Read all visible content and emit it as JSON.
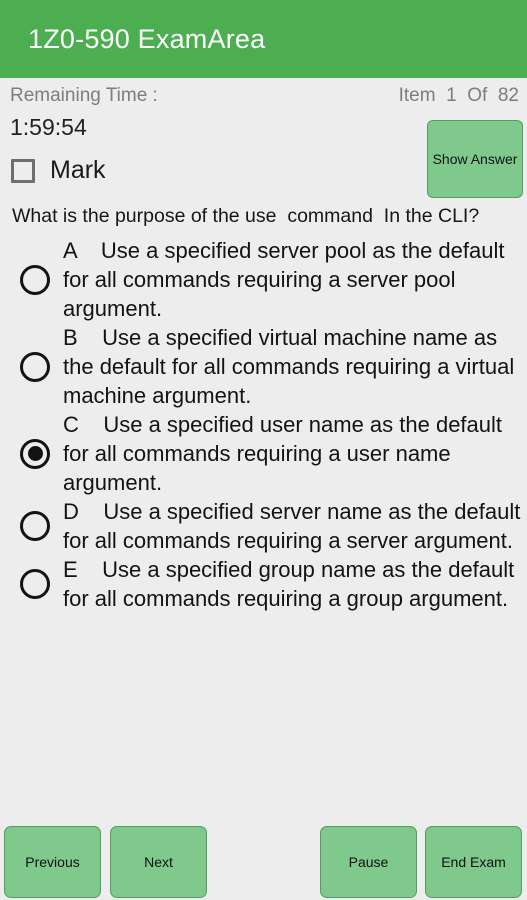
{
  "app": {
    "title": "1Z0-590 ExamArea",
    "accent_color": "#4cae50",
    "button_color": "#7ec98b",
    "background_color": "#ededed"
  },
  "status": {
    "remaining_time_label": "Remaining Time :",
    "item_counter": "Item  1  Of  82"
  },
  "timer": {
    "value": "1:59:54"
  },
  "mark": {
    "label": "Mark",
    "checked": false
  },
  "show_answer": {
    "label": "Show Answer"
  },
  "question": {
    "text": "What is the purpose of the use  command  In the CLI?",
    "options": [
      {
        "letter": "A",
        "text": "A    Use a specified server pool as the default for all commands requiring a server pool argument.",
        "selected": false
      },
      {
        "letter": "B",
        "text": "B    Use a specified virtual machine name as the default for all commands requiring a virtual machine argument.",
        "selected": false
      },
      {
        "letter": "C",
        "text": "C    Use a specified user name as the default for all commands requiring a user name argument.",
        "selected": true
      },
      {
        "letter": "D",
        "text": "D    Use a specified server name as the default for all commands requiring a server argument.",
        "selected": false
      },
      {
        "letter": "E",
        "text": "E    Use a specified group name as the default for all commands requiring a group argument.",
        "selected": false
      }
    ]
  },
  "bottom_bar": {
    "previous_label": "Previous",
    "next_label": "Next",
    "pause_label": "Pause",
    "end_exam_label": "End Exam"
  }
}
